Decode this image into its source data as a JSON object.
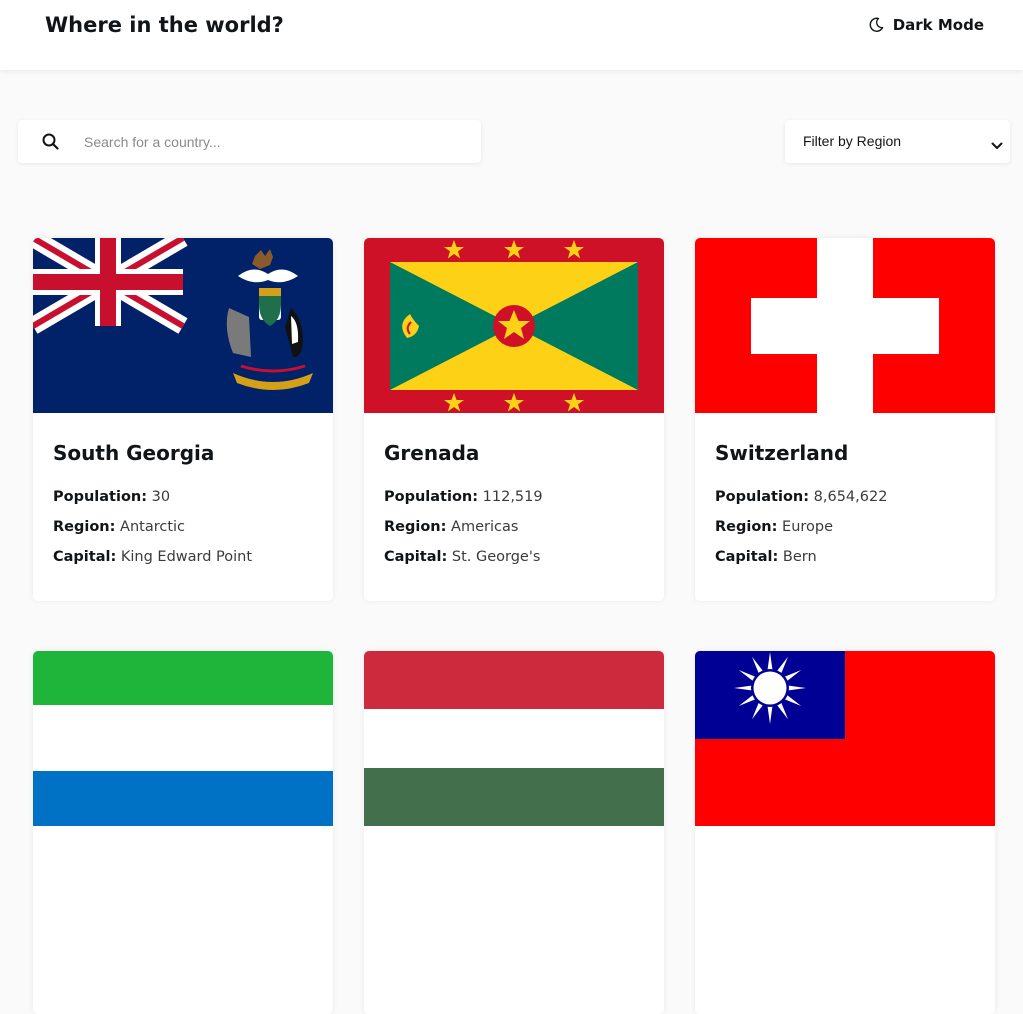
{
  "header": {
    "title": "Where in the world?",
    "theme_toggle_label": "Dark Mode",
    "theme_toggle_icon": "moon-icon"
  },
  "search": {
    "placeholder": "Search for a country...",
    "value": "",
    "icon": "search-icon"
  },
  "filter": {
    "selected_label": "Filter by Region",
    "icon": "chevron-down-icon"
  },
  "labels": {
    "population": "Population:",
    "region": "Region:",
    "capital": "Capital:"
  },
  "countries": [
    {
      "name": "South Georgia",
      "population": "30",
      "region": "Antarctic",
      "capital": "King Edward Point"
    },
    {
      "name": "Grenada",
      "population": "112,519",
      "region": "Americas",
      "capital": "St. George's"
    },
    {
      "name": "Switzerland",
      "population": "8,654,622",
      "region": "Europe",
      "capital": "Bern"
    },
    {
      "name": "",
      "population": "",
      "region": "",
      "capital": ""
    },
    {
      "name": "",
      "population": "",
      "region": "",
      "capital": ""
    },
    {
      "name": "",
      "population": "",
      "region": "",
      "capital": ""
    }
  ],
  "colors": {
    "background": "#fafafa",
    "surface": "#ffffff",
    "text": "#111517"
  }
}
